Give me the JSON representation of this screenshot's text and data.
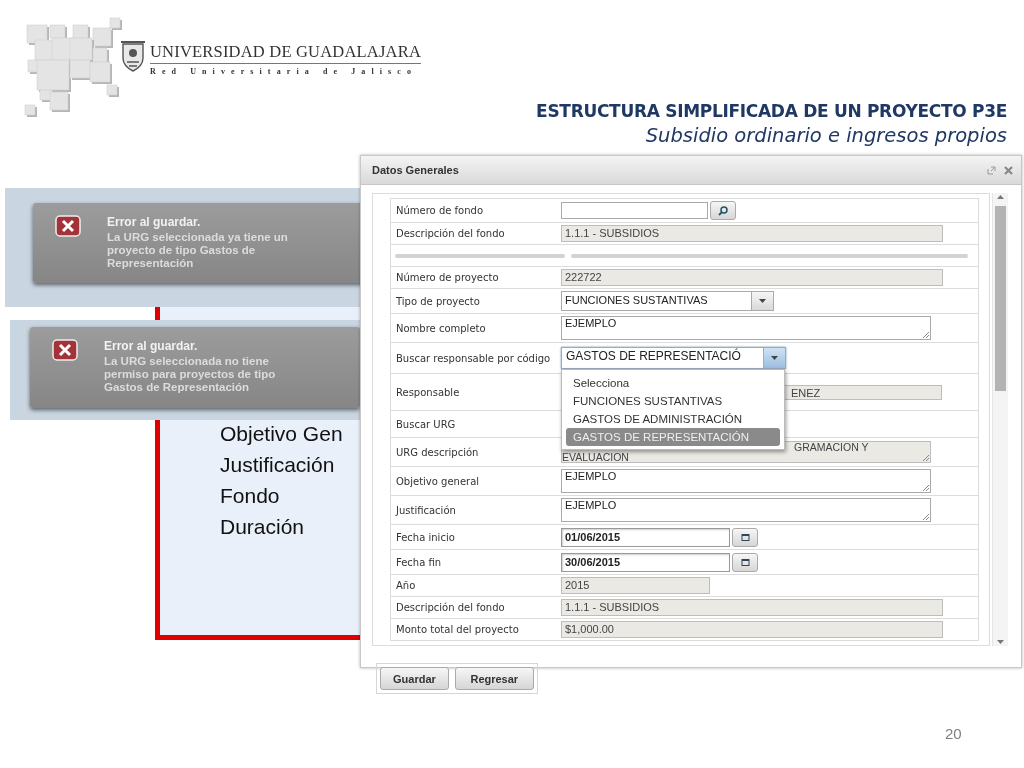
{
  "logo": {
    "name": "UNIVERSIDAD DE GUADALAJARA",
    "tagline": "Red Universitaria de Jalisco"
  },
  "slide_title": "ESTRUCTURA SIMPLIFICADA DE UN PROYECTO P3E",
  "slide_subtitle": "Subsidio ordinario e ingresos propios",
  "outline_items": [
    "Objetivo Gen",
    "Justificación",
    "Fondo",
    "Duración"
  ],
  "error_messages": [
    {
      "title": "Error al guardar.",
      "message": "La URG seleccionada ya tiene un proyecto de tipo Gastos de Representación"
    },
    {
      "title": "Error al guardar.",
      "message": "La URG seleccionada no tiene permiso para proyectos de tipo Gastos de Representación"
    }
  ],
  "dialog": {
    "title": "Datos Generales",
    "fields": [
      {
        "kind": "search",
        "label": "Número de fondo"
      },
      {
        "kind": "readonly",
        "label": "Descripción del fondo",
        "value": "1.1.1 - SUBSIDIOS"
      },
      {
        "kind": "separator"
      },
      {
        "kind": "readonly",
        "label": "Número de proyecto",
        "value": "222722"
      },
      {
        "kind": "select",
        "label": "Tipo de proyecto",
        "value": "FUNCIONES SUSTANTIVAS",
        "expanded": false
      },
      {
        "kind": "textarea",
        "label": "Nombre completo",
        "value": "EJEMPLO"
      },
      {
        "kind": "select",
        "label": "Buscar responsable por código",
        "value": "GASTOS DE REPRESENTACIÓ",
        "expanded": true,
        "options": [
          {
            "label": "Selecciona",
            "selected": false
          },
          {
            "label": "FUNCIONES SUSTANTIVAS",
            "selected": false
          },
          {
            "label": "GASTOS DE ADMINISTRACIÓN",
            "selected": false
          },
          {
            "label": "GASTOS DE REPRESENTACIÓN",
            "selected": true
          }
        ]
      },
      {
        "kind": "covered",
        "label": "Responsable",
        "value": "ENEZ"
      },
      {
        "kind": "label-only",
        "label": "Buscar URG"
      },
      {
        "kind": "covered-area",
        "label": "URG descripción",
        "lines": [
          "GRAMACION Y",
          "EVALUACION"
        ]
      },
      {
        "kind": "textarea",
        "label": "Objetivo general",
        "value": "EJEMPLO"
      },
      {
        "kind": "textarea",
        "label": "Justificación",
        "value": "EJEMPLO"
      },
      {
        "kind": "date",
        "label": "Fecha inicio",
        "value": "01/06/2015"
      },
      {
        "kind": "date",
        "label": "Fecha fin",
        "value": "30/06/2015"
      },
      {
        "kind": "short-readonly",
        "label": "Año",
        "value": "2015"
      },
      {
        "kind": "readonly",
        "label": "Descripción del fondo",
        "value": "1.1.1 - SUBSIDIOS"
      },
      {
        "kind": "readonly",
        "label": "Monto total del proyecto",
        "value": "$1,000.00"
      }
    ],
    "buttons": [
      "Guardar",
      "Regresar"
    ]
  },
  "page_number": "20"
}
